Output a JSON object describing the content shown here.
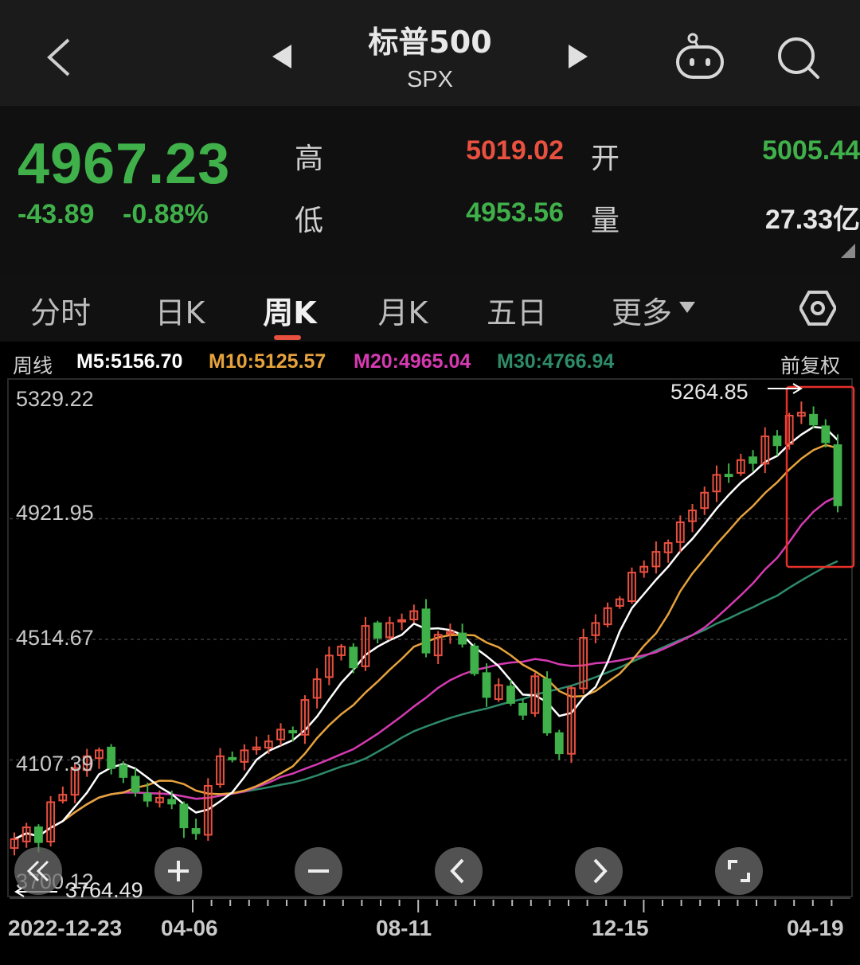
{
  "header": {
    "title": "标普500",
    "symbol": "SPX"
  },
  "quote": {
    "price": "4967.23",
    "change": "-43.89",
    "change_pct": "-0.88%",
    "high_label": "高",
    "high": "5019.02",
    "low_label": "低",
    "low": "4953.56",
    "open_label": "开",
    "open": "5005.44",
    "volume_label": "量",
    "volume": "27.33亿"
  },
  "tabs": [
    {
      "label": "分时"
    },
    {
      "label": "日K"
    },
    {
      "label": "周K"
    },
    {
      "label": "月K"
    },
    {
      "label": "五日"
    },
    {
      "label": "更多"
    }
  ],
  "active_tab": "周K",
  "ma": {
    "label": "周线",
    "m5": "M5:5156.70",
    "m10": "M10:5125.57",
    "m20": "M20:4965.04",
    "m30": "M30:4766.94",
    "adjust": "前复权"
  },
  "colors": {
    "up": "#e8503f",
    "down": "#3fb04a",
    "m5": "#ffffff",
    "m10": "#e6a23c",
    "m20": "#d63ab2",
    "m30": "#2e8b6a"
  },
  "chart_data": {
    "type": "candlestick",
    "period": "weekly",
    "y_ticks": [
      "5329.22",
      "4921.95",
      "4514.67",
      "4107.39",
      "3700.12"
    ],
    "ylim": [
      3700.12,
      5329.22
    ],
    "x_ticks": [
      "2022-12-23",
      "04-06",
      "08-11",
      "12-15",
      "04-19"
    ],
    "max_label": "5264.85",
    "min_label": "3764.49",
    "closes": [
      3840,
      3880,
      3830,
      3965,
      3990,
      4080,
      4120,
      4140,
      4080,
      4050,
      4000,
      3970,
      3980,
      3960,
      3880,
      3860,
      4020,
      4120,
      4110,
      4140,
      4150,
      4170,
      4210,
      4200,
      4310,
      4380,
      4460,
      4490,
      4420,
      4560,
      4520,
      4570,
      4580,
      4610,
      4470,
      4530,
      4540,
      4500,
      4400,
      4320,
      4360,
      4300,
      4260,
      4390,
      4200,
      4130,
      4350,
      4520,
      4570,
      4620,
      4650,
      4740,
      4760,
      4810,
      4840,
      4910,
      4950,
      5010,
      5070,
      5070,
      5120,
      5110,
      5200,
      5170,
      5270,
      5280,
      5240,
      5180,
      4967
    ],
    "ma_values": {
      "m5": "5156.70",
      "m10": "5125.57",
      "m20": "4965.04",
      "m30": "4766.94"
    }
  },
  "controls": [
    "rewind",
    "zoom-in",
    "zoom-out",
    "prev",
    "next",
    "fullscreen"
  ]
}
